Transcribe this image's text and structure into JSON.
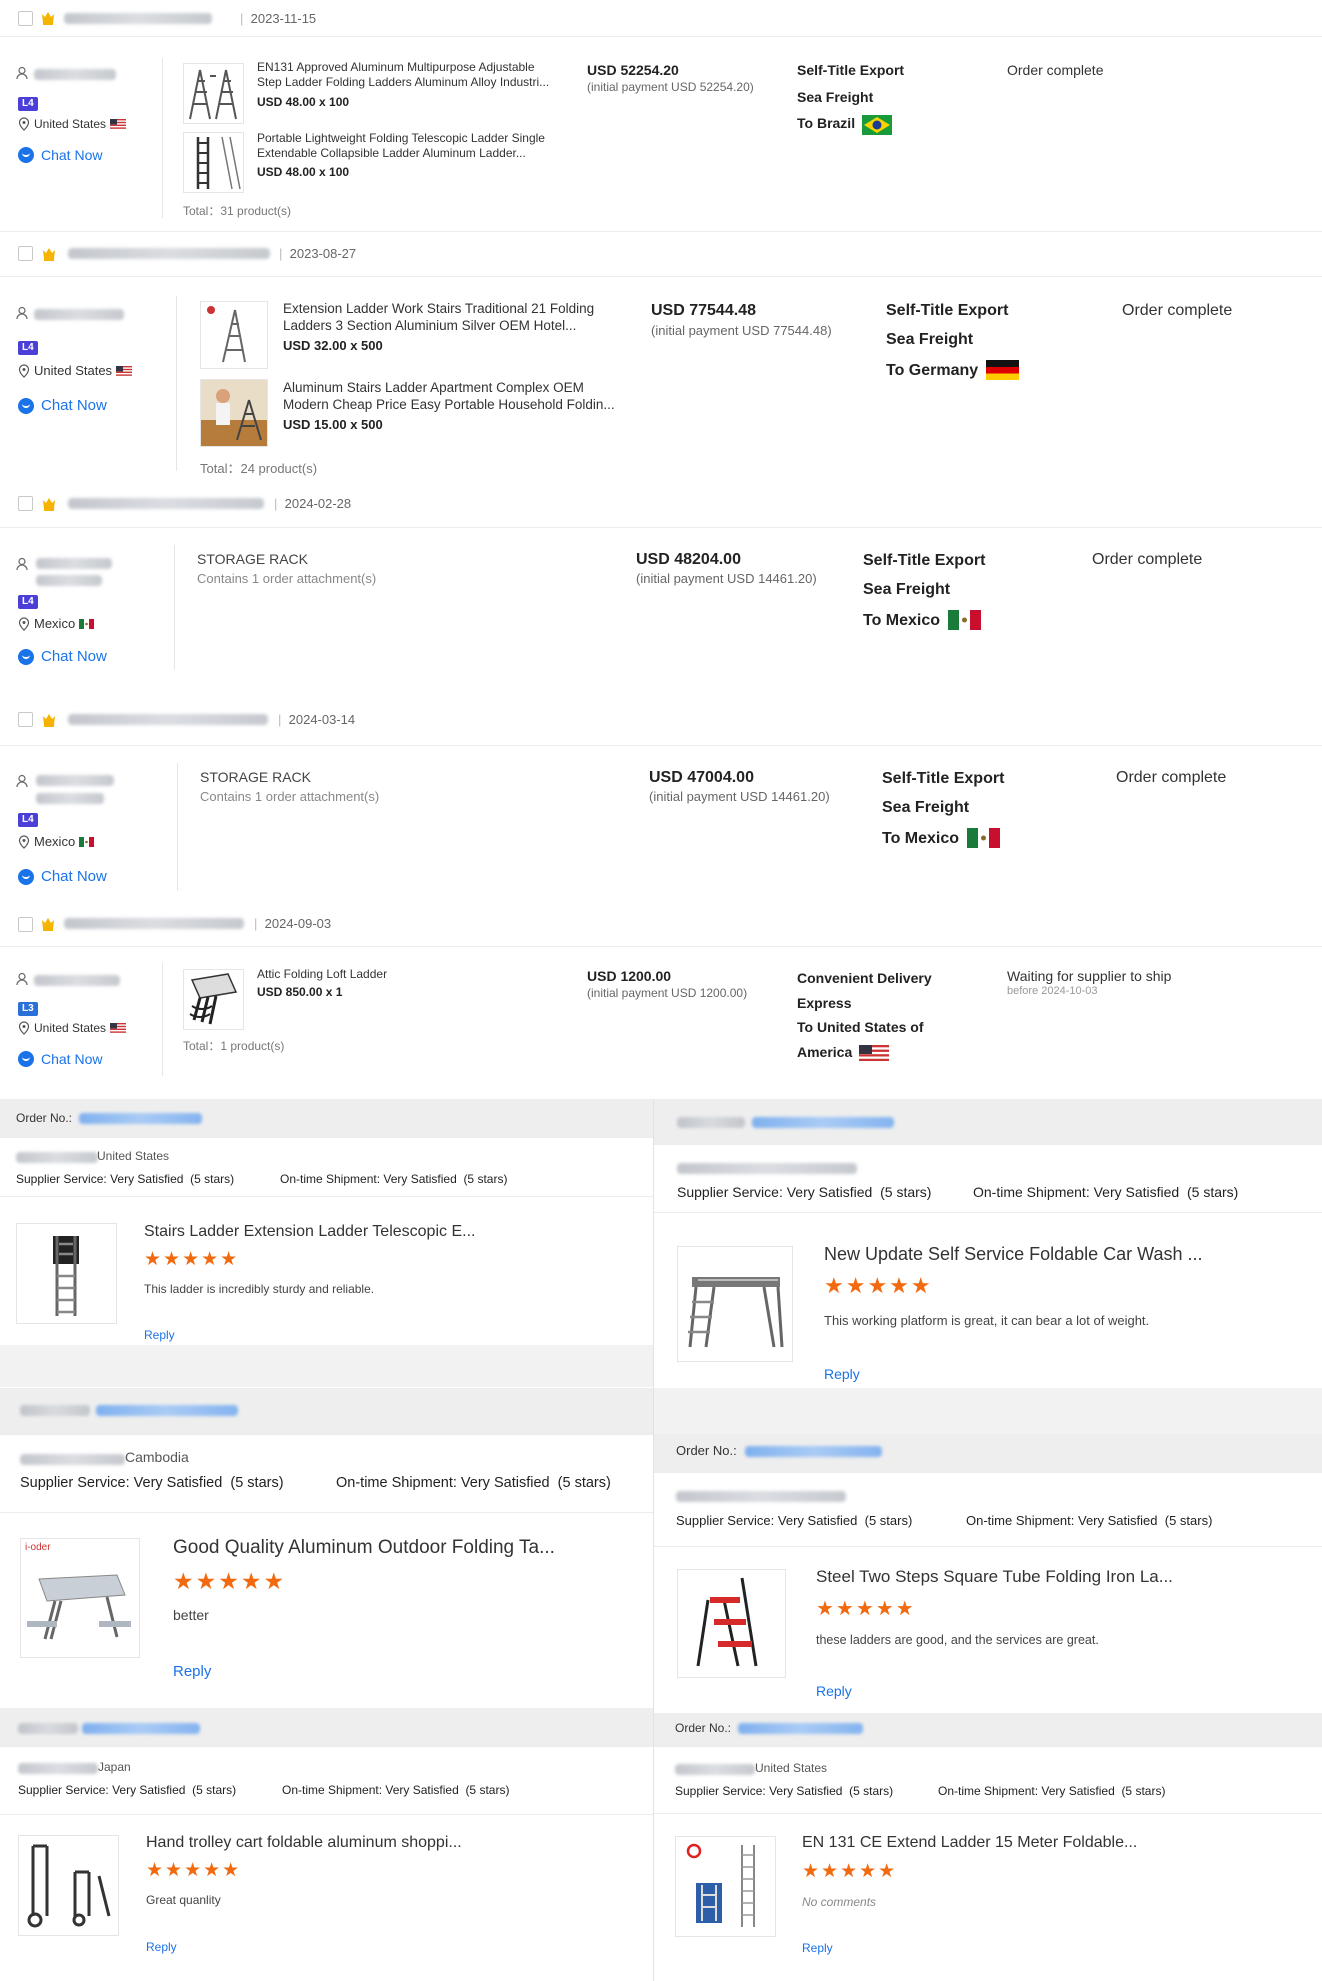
{
  "orders": [
    {
      "date": "2023-11-15",
      "country": "United States",
      "level": "L4",
      "chat": "Chat Now",
      "products": [
        {
          "title_line1": "EN131 Approved Aluminum Multipurpose Adjustable",
          "title_line2": "Step Ladder Folding Ladders Aluminum Alloy Industri...",
          "price": "USD 48.00 x 100"
        },
        {
          "title_line1": "Portable Lightweight Folding Telescopic Ladder Single",
          "title_line2": "Extendable Collapsible Ladder Aluminum Ladder...",
          "price": "USD 48.00 x 100"
        }
      ],
      "total": "Total：31 product(s)",
      "amount": "USD 52254.20",
      "initial": "(initial payment USD 52254.20)",
      "ship1": "Self-Title Export",
      "ship2": "Sea Freight",
      "dest": "To Brazil",
      "status": "Order complete"
    },
    {
      "date": "2023-08-27",
      "country": "United States",
      "level": "L4",
      "chat": "Chat Now",
      "products": [
        {
          "title_line1": "Extension Ladder Work Stairs Traditional 21 Folding",
          "title_line2": "Ladders 3 Section Aluminium Silver OEM Hotel...",
          "price": "USD 32.00 x 500"
        },
        {
          "title_line1": "Aluminum Stairs Ladder Apartment Complex OEM",
          "title_line2": "Modern Cheap Price Easy Portable Household Foldin...",
          "price": "USD 15.00 x 500"
        }
      ],
      "total": "Total：24 product(s)",
      "amount": "USD 77544.48",
      "initial": "(initial payment USD 77544.48)",
      "ship1": "Self-Title Export",
      "ship2": "Sea Freight",
      "dest": "To Germany",
      "status": "Order complete"
    },
    {
      "date": "2024-02-28",
      "country": "Mexico",
      "level": "L4",
      "chat": "Chat Now",
      "rack_title": "STORAGE RACK",
      "rack_sub": "Contains 1 order attachment(s)",
      "amount": "USD 48204.00",
      "initial": "(initial payment USD 14461.20)",
      "ship1": "Self-Title Export",
      "ship2": "Sea Freight",
      "dest": "To Mexico",
      "status": "Order complete"
    },
    {
      "date": "2024-03-14",
      "country": "Mexico",
      "level": "L4",
      "chat": "Chat Now",
      "rack_title": "STORAGE RACK",
      "rack_sub": "Contains 1 order attachment(s)",
      "amount": "USD 47004.00",
      "initial": "(initial payment USD 14461.20)",
      "ship1": "Self-Title Export",
      "ship2": "Sea Freight",
      "dest": "To Mexico",
      "status": "Order complete"
    },
    {
      "date": "2024-09-03",
      "country": "United States",
      "level": "L3",
      "chat": "Chat Now",
      "products": [
        {
          "title_line1": "Attic Folding Loft Ladder",
          "title_line2": "",
          "price": "USD 850.00 x 1"
        }
      ],
      "total": "Total：1 product(s)",
      "amount": "USD 1200.00",
      "initial": "(initial payment USD 1200.00)",
      "ship1": "Convenient Delivery",
      "ship2": "Express",
      "dest": "To United States of",
      "dest2": "America",
      "status": "Waiting for supplier to ship",
      "status_sub": "before 2024-10-03"
    }
  ],
  "reviews": {
    "order_label": "Order No.:",
    "supplier_label": "Supplier Service:",
    "shipment_label": "On-time Shipment:",
    "rating_value": "Very Satisfied",
    "rating_stars": "(5 stars)",
    "reply": "Reply",
    "stars": "★★★★★",
    "items": [
      {
        "country": "United States",
        "title": "Stairs Ladder Extension Ladder Telescopic E...",
        "comment": "This ladder is incredibly sturdy and reliable."
      },
      {
        "country": "",
        "title": "New Update Self Service Foldable Car Wash ...",
        "comment": "This working platform is great, it can bear a lot of weight."
      },
      {
        "country": "Cambodia",
        "title": "Good Quality Aluminum Outdoor Folding Ta...",
        "comment": "better",
        "thumb_brand": "i-oder"
      },
      {
        "country": "",
        "title": "Steel Two Steps Square Tube Folding Iron La...",
        "comment": "these ladders are good, and the services are great."
      },
      {
        "country": "Japan",
        "title": "Hand trolley cart foldable aluminum shoppi...",
        "comment": "Great quanlity"
      },
      {
        "country": "United States",
        "title": "EN 131 CE Extend Ladder 15 Meter Foldable...",
        "comment": "No comments"
      }
    ]
  },
  "colors": {
    "accent": "#1a73e8",
    "star": "#f26a10",
    "level": "#4b3fd8"
  }
}
